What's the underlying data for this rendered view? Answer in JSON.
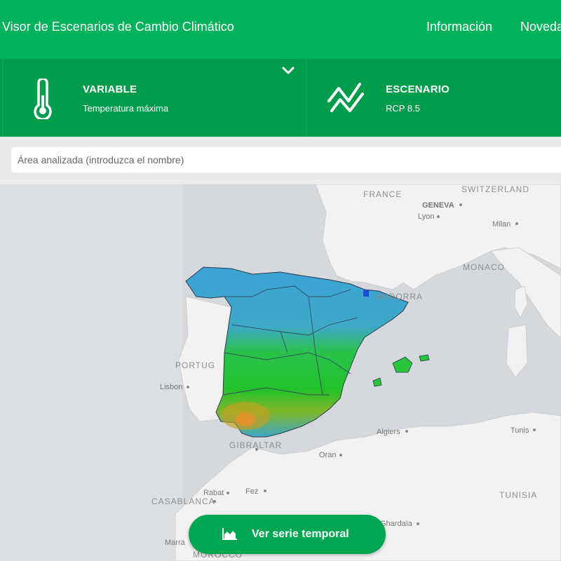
{
  "header": {
    "title": "Visor de Escenarios de Cambio Climático",
    "nav": [
      "Información",
      "Noveda"
    ]
  },
  "selectors": {
    "variable": {
      "title": "VARIABLE",
      "value": "Temperatura máxima",
      "icon": "thermometer-icon"
    },
    "scenario": {
      "title": "ESCENARIO",
      "value": "RCP 8.5",
      "icon": "trend-lines-icon"
    }
  },
  "search": {
    "placeholder": "Área analizada (introduzca el nombre)",
    "value": ""
  },
  "map": {
    "country_labels": [
      "FRANCE",
      "SWITZERLAND",
      "MONACO",
      "PORTUG",
      "GIBRALTAR",
      "TUNISIA"
    ],
    "city_labels": [
      "GENEVA",
      "Lyon",
      "Milan",
      "Lisbon",
      "Algiers",
      "Oran",
      "Tunis",
      "Rabat",
      "Fez",
      "CASABLANCA",
      "Ghardaïa",
      "Marra",
      "ANDORRA",
      "MOROCCO"
    ],
    "colors": {
      "hot": "#e8902a",
      "mid": "#22c22a",
      "cool": "#3aa3d6",
      "cold": "#1f4dd1"
    }
  },
  "action": {
    "label": "Ver serie temporal",
    "icon": "area-chart-icon"
  },
  "colors": {
    "brand": "#00b25c",
    "brand_dark": "#009c4b",
    "button": "#00a651"
  }
}
